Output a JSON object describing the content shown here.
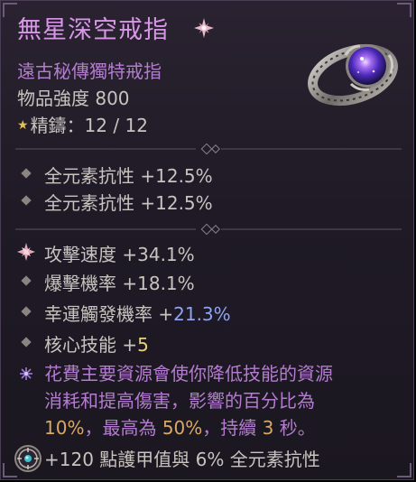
{
  "item": {
    "name": "無星深空戒指",
    "type_line": "遠古秘傳獨特戒指",
    "power_line": "物品強度 800",
    "masterwork_label": "精鑄",
    "masterwork_value": "：12 / 12"
  },
  "implicits": [
    {
      "label": "全元素抗性",
      "value": "+12.5%"
    },
    {
      "label": "全元素抗性",
      "value": "+12.5%"
    }
  ],
  "affixes": [
    {
      "label": "攻擊速度",
      "value": "+34.1%"
    },
    {
      "label": "爆擊機率",
      "value": "+18.1%"
    },
    {
      "label": "幸運觸發機率",
      "value_prefix": "+",
      "value": "21.3%"
    },
    {
      "label": "核心技能",
      "value_prefix": "+",
      "value": "5"
    }
  ],
  "legendary": {
    "line1": "花費主要資源會使你降低技能的資源",
    "line2": "消耗和提高傷害，影響的百分比為",
    "value1": "10%",
    "mid": "，最高為",
    "value2": "50%",
    "mid2": "，持續",
    "value3": "3",
    "end": "秒。"
  },
  "socket": {
    "text": "+120 點護甲值與 6% 全元素抗性"
  },
  "colors": {
    "title": "#d996e8",
    "unique_text": "#b47cd0",
    "greater_affix": "#8fa5f2",
    "masterwork_upgrade": "#e5d27a",
    "legendary_value": "#d8a965"
  },
  "icons": [
    "star-badge-icon",
    "ring-icon",
    "greater-affix-icon",
    "legendary-aspect-icon",
    "socket-gem-icon",
    "diamond-bullet-icon"
  ]
}
